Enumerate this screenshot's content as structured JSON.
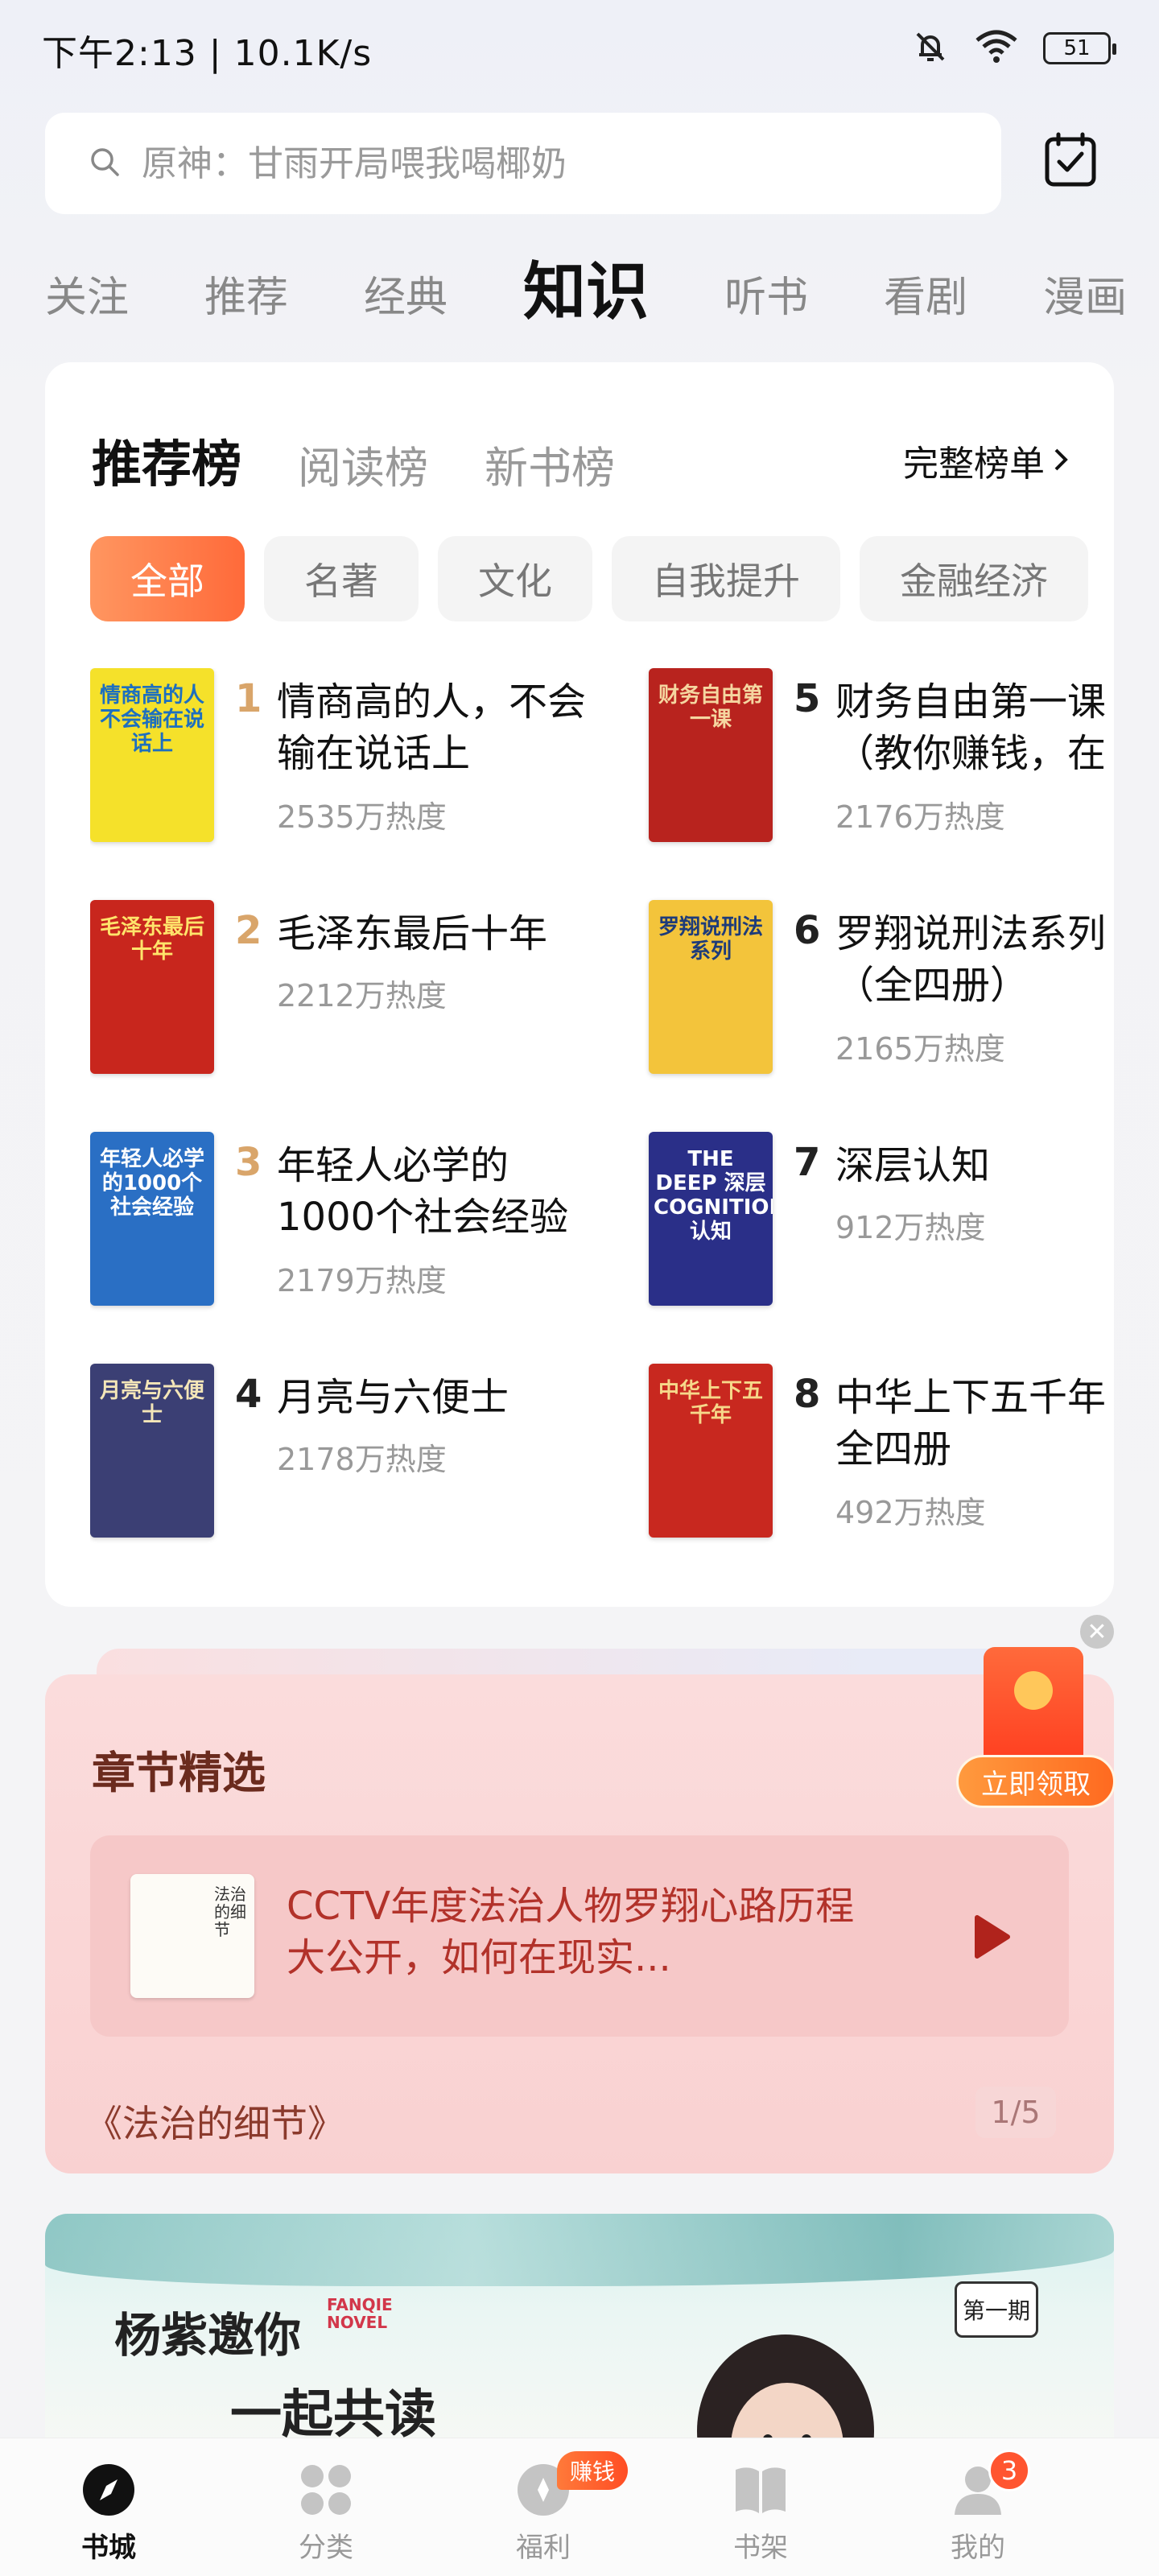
{
  "status_bar": {
    "time_speed": "下午2:13 | 10.1K/s",
    "battery": "51"
  },
  "search": {
    "placeholder": "原神：甘雨开局喂我喝椰奶"
  },
  "channel_tabs": [
    "关注",
    "推荐",
    "经典",
    "知识",
    "听书",
    "看剧",
    "漫画"
  ],
  "active_channel": "知识",
  "ranking": {
    "tabs": [
      "推荐榜",
      "阅读榜",
      "新书榜"
    ],
    "active_tab": "推荐榜",
    "full_list_label": "完整榜单",
    "chips": [
      "全部",
      "名著",
      "文化",
      "自我提升",
      "金融经济"
    ],
    "active_chip": "全部",
    "books": [
      {
        "rank": "1",
        "title": "情商高的人，不会\n输在说话上",
        "heat": "2535万热度",
        "cover_text": "情商高的人不会输在说话上",
        "cover_color": "#f5e12a",
        "cover_fg": "#1d6fbf",
        "rank_color": "#d9a56a"
      },
      {
        "rank": "2",
        "title": "毛泽东最后十年",
        "heat": "2212万热度",
        "cover_text": "毛泽东最后十年",
        "cover_color": "#c8261d",
        "cover_fg": "#ffe46b",
        "rank_color": "#d9a56a"
      },
      {
        "rank": "3",
        "title": "年轻人必学的\n1000个社会经验",
        "heat": "2179万热度",
        "cover_text": "年轻人必学的1000个社会经验",
        "cover_color": "#2a6fc4",
        "cover_fg": "#ffffff",
        "rank_color": "#d9a56a"
      },
      {
        "rank": "4",
        "title": "月亮与六便士",
        "heat": "2178万热度",
        "cover_text": "月亮与六便士",
        "cover_color": "#3b3f74",
        "cover_fg": "#f4e6b8",
        "rank_color": "#222222"
      },
      {
        "rank": "5",
        "title": "财务自由第一课\n（教你赚钱，在",
        "heat": "2176万热度",
        "cover_text": "财务自由第一课",
        "cover_color": "#b8231e",
        "cover_fg": "#f5d6a0",
        "rank_color": "#222222"
      },
      {
        "rank": "6",
        "title": "罗翔说刑法系列\n（全四册）",
        "heat": "2165万热度",
        "cover_text": "罗翔说刑法系列",
        "cover_color": "#f3c43b",
        "cover_fg": "#1d3b7a",
        "rank_color": "#222222"
      },
      {
        "rank": "7",
        "title": "深层认知",
        "heat": "912万热度",
        "cover_text": "THE DEEP 深层 COGNITION 认知",
        "cover_color": "#2a2f88",
        "cover_fg": "#ffffff",
        "rank_color": "#222222"
      },
      {
        "rank": "8",
        "title": "中华上下五千年\n全四册",
        "heat": "492万热度",
        "cover_text": "中华上下五千年",
        "cover_color": "#c8281f",
        "cover_fg": "#f6d88a",
        "rank_color": "#222222"
      }
    ]
  },
  "chapter": {
    "section_title": "章节精选",
    "text": "CCTV年度法治人物罗翔心路历程大公开，如何在现实...",
    "cover_text": "法治的细节",
    "book_name": "《法治的细节》",
    "pager": "1/5"
  },
  "ad": {
    "claim_label": "立即领取",
    "close_symbol": "✕"
  },
  "promo": {
    "line1": "杨紫邀你",
    "line2": "一起共读",
    "brand": "FANQIE\nNOVEL",
    "issue": "第一期"
  },
  "bottom_nav": [
    {
      "label": "书城",
      "icon": "compass-icon",
      "active": true
    },
    {
      "label": "分类",
      "icon": "grid-icon",
      "active": false
    },
    {
      "label": "福利",
      "icon": "gift-icon",
      "active": false,
      "badge": "赚钱"
    },
    {
      "label": "书架",
      "icon": "book-icon",
      "active": false
    },
    {
      "label": "我的",
      "icon": "user-icon",
      "active": false,
      "badge": "3"
    }
  ],
  "colors": {
    "accent": "#ff6a3a",
    "chapter_bg": "#f9d1d1"
  }
}
